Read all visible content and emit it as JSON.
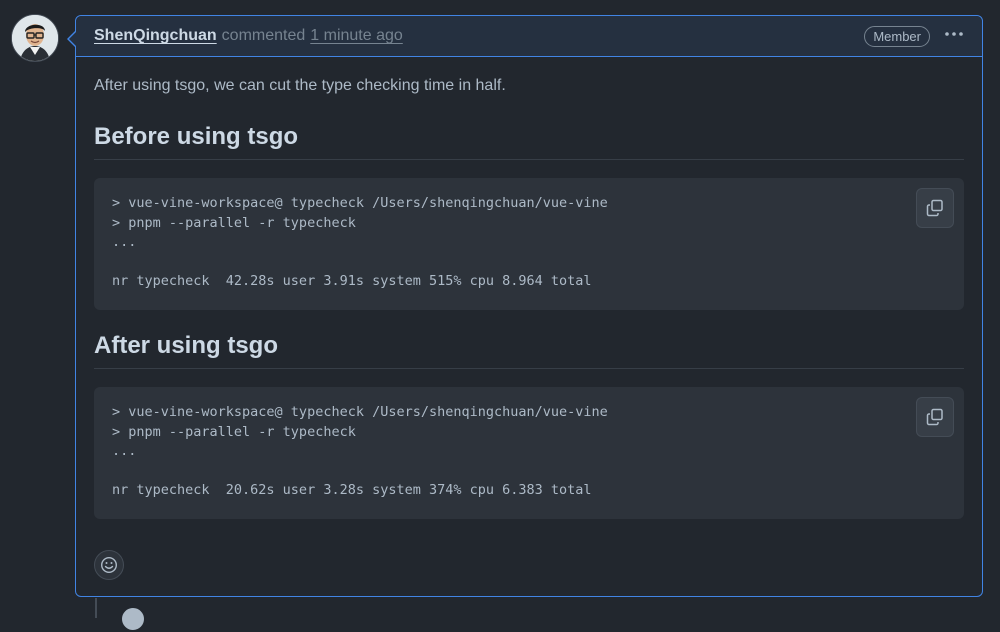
{
  "comment": {
    "author": "ShenQingchuan",
    "action": "commented",
    "time": "1 minute ago",
    "badge": "Member",
    "menu_icon": "kebab-horizontal-icon",
    "reaction_icon": "smiley-icon"
  },
  "body": {
    "intro": "After using tsgo, we can cut the type checking time in half.",
    "sections": [
      {
        "heading": "Before using tsgo",
        "code": "> vue-vine-workspace@ typecheck /Users/shenqingchuan/vue-vine\n> pnpm --parallel -r typecheck\n...\n\nnr typecheck  42.28s user 3.91s system 515% cpu 8.964 total",
        "copy_icon": "copy-icon"
      },
      {
        "heading": "After using tsgo",
        "code": "> vue-vine-workspace@ typecheck /Users/shenqingchuan/vue-vine\n> pnpm --parallel -r typecheck\n...\n\nnr typecheck  20.62s user 3.28s system 374% cpu 6.383 total",
        "copy_icon": "copy-icon"
      }
    ]
  },
  "colors": {
    "background": "#22272e",
    "header_background": "#253040",
    "accent_border": "#4184e4",
    "code_background": "#2d333b"
  }
}
